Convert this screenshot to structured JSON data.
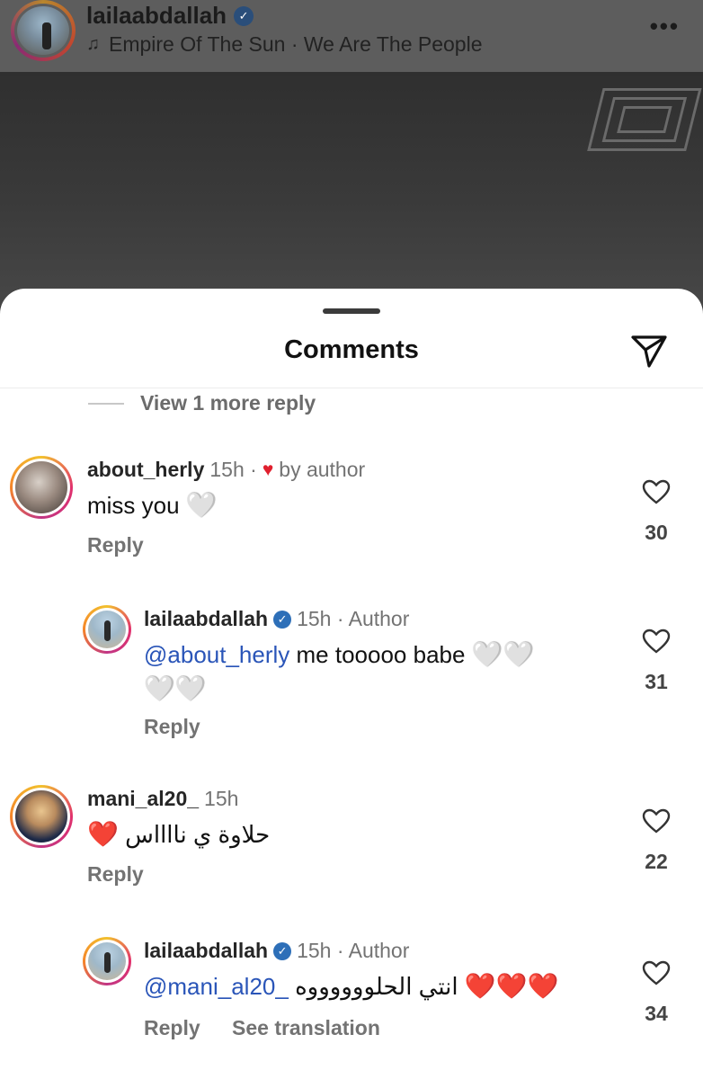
{
  "header": {
    "username": "lailaabdallah",
    "song": "Empire Of The Sun · We Are The People",
    "more": "•••"
  },
  "sheet": {
    "title": "Comments",
    "view_more_replies": "View 1 more reply"
  },
  "comments": [
    {
      "username": "about_herly",
      "time": "15h ·",
      "liked_by_author": "by author",
      "text": "miss you",
      "emoji": "🤍",
      "reply": "Reply",
      "likes": "30"
    },
    {
      "username": "lailaabdallah",
      "time": "15h · Author",
      "mention": "@about_herly",
      "text": "me tooooo babe",
      "emoji_line1": "🤍🤍",
      "emoji_line2": "🤍🤍",
      "reply": "Reply",
      "likes": "31"
    },
    {
      "username": "mani_al20_",
      "time": "15h",
      "text": "حلاوة ي نااااس",
      "emoji": "❤️",
      "reply": "Reply",
      "likes": "22"
    },
    {
      "username": "lailaabdallah",
      "time": "15h · Author",
      "mention": "@mani_al20_",
      "text": "انتي الحلووووووه",
      "emoji": "❤️❤️❤️",
      "reply": "Reply",
      "see_translation": "See translation",
      "likes": "34"
    }
  ],
  "colors": {
    "mention": "#2a55b8",
    "verified": "#2d6fb8",
    "liked_heart": "#e0202e"
  }
}
